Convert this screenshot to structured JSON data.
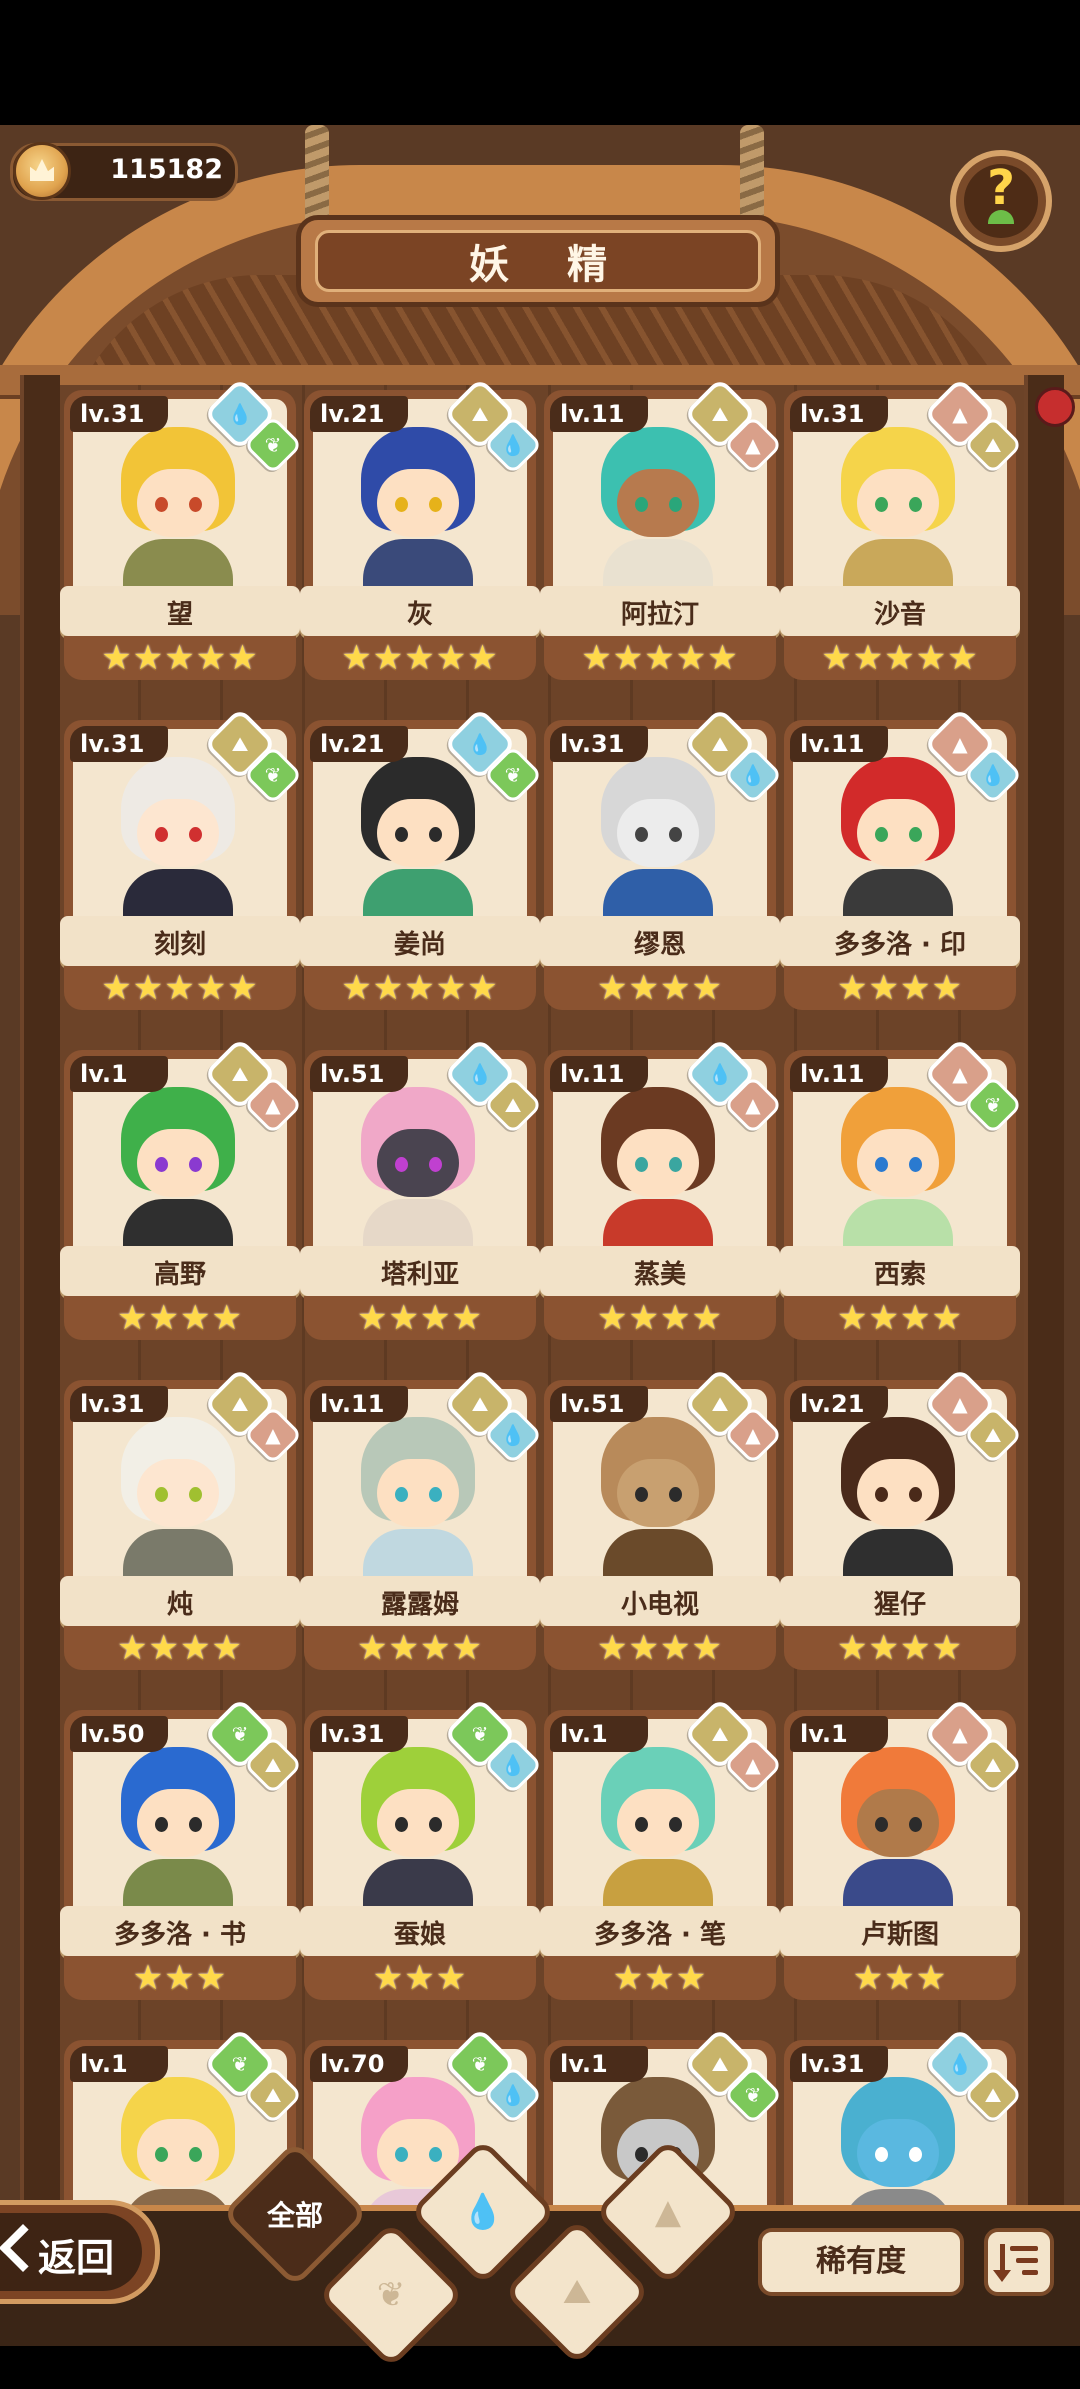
{
  "header": {
    "currency_value": "115182",
    "title": "妖 精"
  },
  "colors": {
    "wood_dark": "#4a2c1a",
    "wood": "#8b5331",
    "parchment": "#f4e6cf",
    "star": "#ffd94a",
    "element_water": "#8fd0e0",
    "element_earth": "#c8b46a",
    "element_fire": "#d9a08a",
    "element_plant": "#7cc85a"
  },
  "cards": [
    {
      "level": "lv.31",
      "name": "望",
      "stars": "★★★★★",
      "elements": [
        "water",
        "plant"
      ],
      "hair": "#f2c437",
      "skin": "#fde0c2",
      "body": "#8a8c4e",
      "eye": "#c84a2a"
    },
    {
      "level": "lv.21",
      "name": "灰",
      "stars": "★★★★★",
      "elements": [
        "earth",
        "water"
      ],
      "hair": "#2f4ba8",
      "skin": "#fde0c2",
      "body": "#3a4a7a",
      "eye": "#e6b21a"
    },
    {
      "level": "lv.11",
      "name": "阿拉汀",
      "stars": "★★★★★",
      "elements": [
        "earth",
        "fire"
      ],
      "hair": "#3cc0b0",
      "skin": "#b77a4e",
      "body": "#e9e1d0",
      "eye": "#2aa67a"
    },
    {
      "level": "lv.31",
      "name": "沙音",
      "stars": "★★★★★",
      "elements": [
        "fire",
        "earth"
      ],
      "hair": "#f5d44a",
      "skin": "#fde0c2",
      "body": "#c9a85a",
      "eye": "#3aa65a"
    },
    {
      "level": "lv.31",
      "name": "刻刻",
      "stars": "★★★★★",
      "elements": [
        "earth",
        "plant"
      ],
      "hair": "#eeeae4",
      "skin": "#fde6d0",
      "body": "#2a2a3a",
      "eye": "#d03030"
    },
    {
      "level": "lv.21",
      "name": "姜尚",
      "stars": "★★★★★",
      "elements": [
        "water",
        "plant"
      ],
      "hair": "#2b2b2b",
      "skin": "#fde0c2",
      "body": "#3ea070",
      "eye": "#2b2b2b"
    },
    {
      "level": "lv.31",
      "name": "缪恩",
      "stars": "★★★★",
      "elements": [
        "earth",
        "water"
      ],
      "hair": "#d7d7d7",
      "skin": "#ececec",
      "body": "#2f5fa8",
      "eye": "#444444"
    },
    {
      "level": "lv.11",
      "name": "多多洛 · 印",
      "stars": "★★★★",
      "elements": [
        "fire",
        "water"
      ],
      "hair": "#d22a2a",
      "skin": "#fde0c2",
      "body": "#3a3a3a",
      "eye": "#3aa65a"
    },
    {
      "level": "lv.1",
      "name": "高野",
      "stars": "★★★★",
      "elements": [
        "earth",
        "fire"
      ],
      "hair": "#3fb04a",
      "skin": "#fde0c2",
      "body": "#2f2f2f",
      "eye": "#8a3ad0"
    },
    {
      "level": "lv.51",
      "name": "塔利亚",
      "stars": "★★★★",
      "elements": [
        "water",
        "earth"
      ],
      "hair": "#f0a8c8",
      "skin": "#4a4450",
      "body": "#e6d8c8",
      "eye": "#c040d0"
    },
    {
      "level": "lv.11",
      "name": "蒸美",
      "stars": "★★★★",
      "elements": [
        "water",
        "fire"
      ],
      "hair": "#6b3a22",
      "skin": "#fde0c2",
      "body": "#c83a2a",
      "eye": "#3aa6a0"
    },
    {
      "level": "lv.11",
      "name": "西索",
      "stars": "★★★★",
      "elements": [
        "fire",
        "plant"
      ],
      "hair": "#f0a03a",
      "skin": "#fde0c2",
      "body": "#b8e0a8",
      "eye": "#2a7ad0"
    },
    {
      "level": "lv.31",
      "name": "炖",
      "stars": "★★★★",
      "elements": [
        "earth",
        "fire"
      ],
      "hair": "#f2efe6",
      "skin": "#fde6d0",
      "body": "#7a7a6a",
      "eye": "#a0c030"
    },
    {
      "level": "lv.11",
      "name": "露露姆",
      "stars": "★★★★",
      "elements": [
        "earth",
        "water"
      ],
      "hair": "#b8c8b8",
      "skin": "#fde0c2",
      "body": "#c0d8e0",
      "eye": "#3ab0c0"
    },
    {
      "level": "lv.51",
      "name": "小电视",
      "stars": "★★★★",
      "elements": [
        "earth",
        "fire"
      ],
      "hair": "#b88a5a",
      "skin": "#c8a070",
      "body": "#6a4a2a",
      "eye": "#2b2b2b"
    },
    {
      "level": "lv.21",
      "name": "猩仔",
      "stars": "★★★★",
      "elements": [
        "fire",
        "earth"
      ],
      "hair": "#4a2a1a",
      "skin": "#fde0c2",
      "body": "#2f2f2f",
      "eye": "#4a2a1a"
    },
    {
      "level": "lv.50",
      "name": "多多洛 · 书",
      "stars": "★★★",
      "elements": [
        "plant",
        "earth"
      ],
      "hair": "#2a6ad0",
      "skin": "#fde0c2",
      "body": "#7a8a4a",
      "eye": "#2b2b2b"
    },
    {
      "level": "lv.31",
      "name": "蚕娘",
      "stars": "★★★",
      "elements": [
        "plant",
        "water"
      ],
      "hair": "#9ed03a",
      "skin": "#fde0c2",
      "body": "#3a3a4a",
      "eye": "#2b2b2b"
    },
    {
      "level": "lv.1",
      "name": "多多洛 · 笔",
      "stars": "★★★",
      "elements": [
        "earth",
        "fire"
      ],
      "hair": "#6ad0b8",
      "skin": "#fde0c2",
      "body": "#c8a040",
      "eye": "#2b2b2b"
    },
    {
      "level": "lv.1",
      "name": "卢斯图",
      "stars": "★★★",
      "elements": [
        "fire",
        "earth"
      ],
      "hair": "#f07a3a",
      "skin": "#b07a4a",
      "body": "#3a4a8a",
      "eye": "#2b2b2b"
    },
    {
      "level": "lv.1",
      "name": "",
      "stars": "",
      "elements": [
        "plant",
        "earth"
      ],
      "hair": "#f5d44a",
      "skin": "#fde0c2",
      "body": "#8a6a4a",
      "eye": "#3aa65a"
    },
    {
      "level": "lv.70",
      "name": "",
      "stars": "",
      "elements": [
        "plant",
        "water"
      ],
      "hair": "#f5a0c8",
      "skin": "#fde0c2",
      "body": "#e8c8d8",
      "eye": "#3ab0c0"
    },
    {
      "level": "lv.1",
      "name": "",
      "stars": "",
      "elements": [
        "earth",
        "plant"
      ],
      "hair": "#7a5a3a",
      "skin": "#c8c8c8",
      "body": "#5a4a3a",
      "eye": "#2b2b2b"
    },
    {
      "level": "lv.31",
      "name": "",
      "stars": "",
      "elements": [
        "water",
        "earth"
      ],
      "hair": "#4ab0d0",
      "skin": "#5ab8e0",
      "body": "#8a8a8a",
      "eye": "#ffffff"
    }
  ],
  "bottom_bar": {
    "back_label": "返回",
    "filter_all_label": "全部",
    "filters": [
      "water",
      "plant",
      "earth",
      "fire"
    ],
    "rarity_label": "稀有度"
  }
}
